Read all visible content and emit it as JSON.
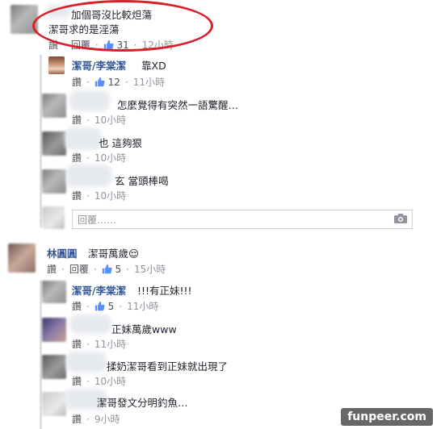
{
  "labels": {
    "reply": "回覆",
    "praise": "讚",
    "reply_placeholder": "回覆……"
  },
  "comments": [
    {
      "text": "加個哥沒比較炟蕩",
      "text2": "潔哥求的是淫蕩",
      "likes": "31",
      "time": "12小時"
    },
    {
      "name": "潔哥/李棠潔",
      "text": "靠XD",
      "likes": "12",
      "time": "11小時"
    },
    {
      "text": "怎麼覺得有突然一語驚醒…",
      "time": "10小時"
    },
    {
      "text": "也 這夠狠",
      "time": "10小時"
    },
    {
      "text": "玄 當頭棒喝",
      "time": "10小時"
    },
    {
      "name": "林圓圓",
      "text": "潔哥萬歲😌",
      "likes": "5",
      "time": "15小時"
    },
    {
      "name": "潔哥/李棠潔",
      "text": "!!!有正妹!!!",
      "likes": "5",
      "time": "11小時"
    },
    {
      "text": "正妹萬歲www",
      "time": "11小時"
    },
    {
      "text": "揉奶潔哥看到正妹就出現了",
      "time": "10小時"
    },
    {
      "text": "潔哥發文分明釣魚…",
      "time": "9小時"
    }
  ],
  "watermark": "funpeer.com",
  "colors": {
    "link": "#365899",
    "meta": "#90949c",
    "annotation": "#d9202a",
    "like": "#5890ff"
  }
}
